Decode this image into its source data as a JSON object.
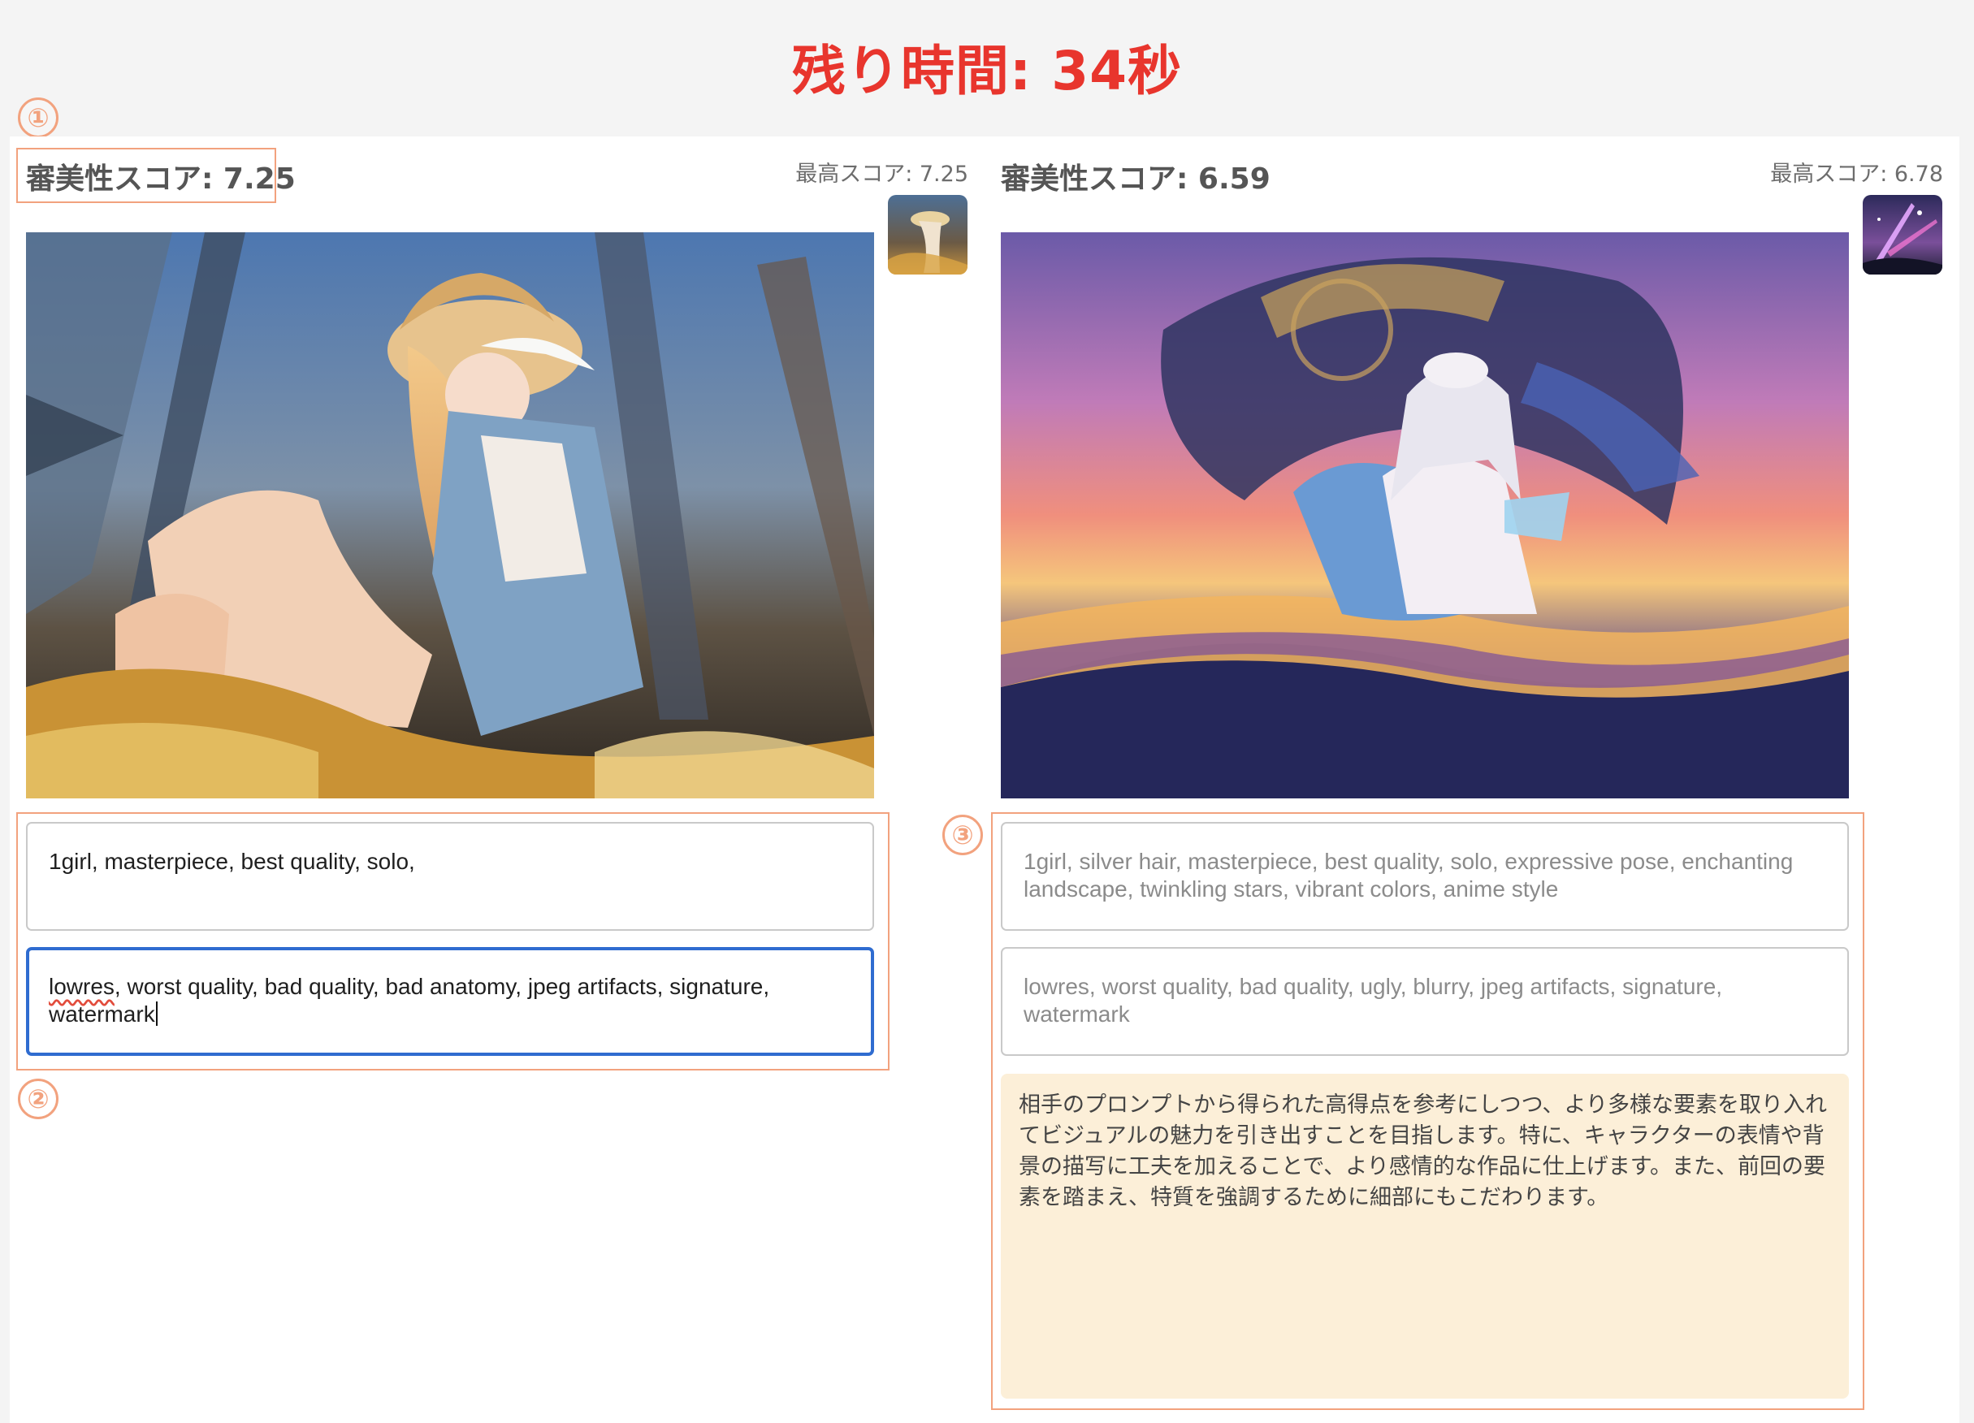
{
  "header": {
    "timer": "残り時間: 34秒"
  },
  "badges": {
    "one": "①",
    "two": "②",
    "three": "③"
  },
  "left": {
    "score_label": "審美性スコア: 7.25",
    "best_label": "最高スコア: 7.25",
    "prompt": "1girl, masterpiece, best quality, solo,",
    "negative_prompt_word": "lowres",
    "negative_prompt_rest": ", worst quality, bad quality, bad anatomy, jpeg artifacts, signature, watermark"
  },
  "right": {
    "score_label": "審美性スコア: 6.59",
    "best_label": "最高スコア: 6.78",
    "prompt": "1girl, silver hair, masterpiece, best quality, solo, expressive pose, enchanting landscape, twinkling stars, vibrant colors, anime style",
    "negative_prompt": "lowres, worst quality, bad quality, ugly, blurry, jpeg artifacts, signature, watermark",
    "reasoning": "相手のプロンプトから得られた高得点を参考にしつつ、より多様な要素を取り入れてビジュアルの魅力を引き出すことを目指します。特に、キャラクターの表情や背景の描写に工夫を加えることで、より感情的な作品に仕上げます。また、前回の要素を踏まえ、特質を強調するために細部にもこだわります。"
  },
  "colors": {
    "accent": "#e8352d",
    "annotation": "#f2a27e",
    "focus": "#2f6cd0",
    "reasoning_bg": "#fcefd8"
  }
}
